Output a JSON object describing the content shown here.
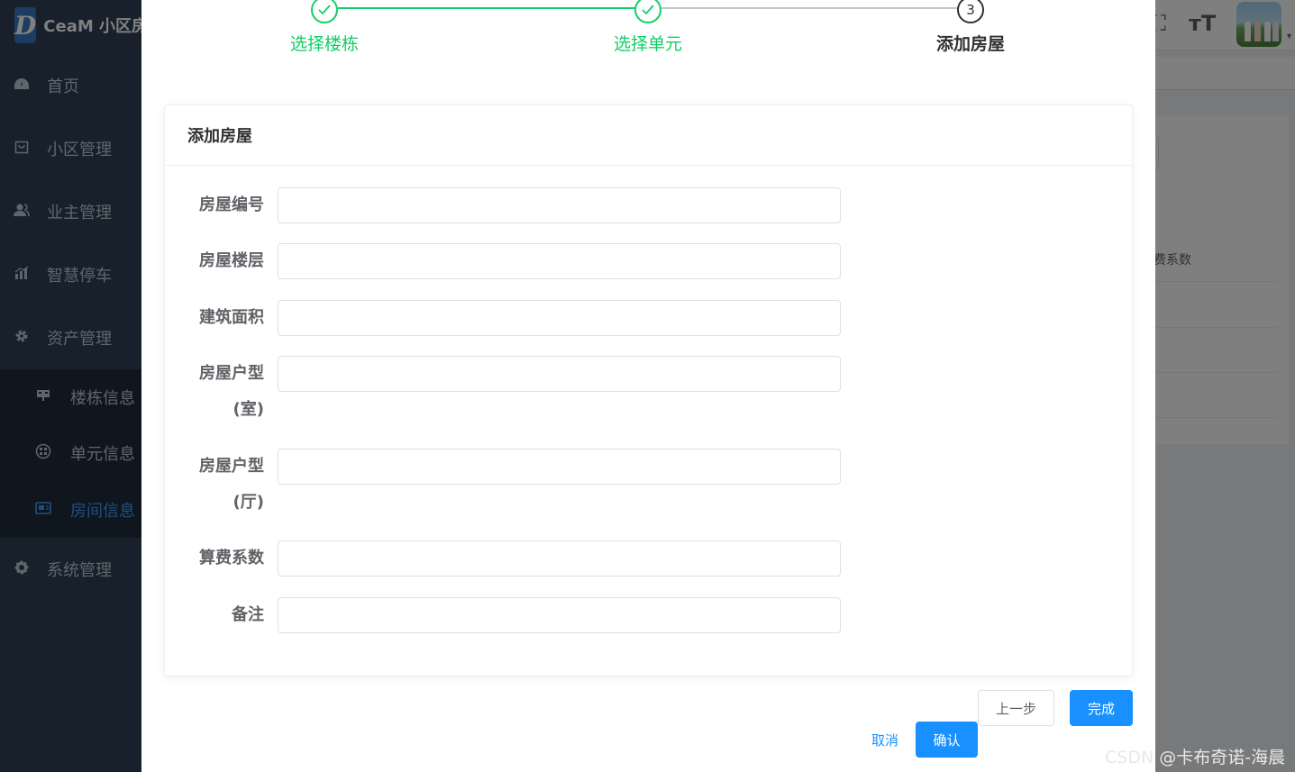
{
  "app": {
    "brand_letter": "D",
    "brand_title": "CeaM 小区房"
  },
  "sidebar": {
    "items": [
      {
        "label": "首页",
        "icon": "dashboard-icon"
      },
      {
        "label": "小区管理",
        "icon": "shopping-icon"
      },
      {
        "label": "业主管理",
        "icon": "peoples-icon"
      },
      {
        "label": "智慧停车",
        "icon": "chart-icon"
      },
      {
        "label": "资产管理",
        "icon": "gear-icon"
      },
      {
        "label": "系统管理",
        "icon": "system-icon"
      }
    ],
    "subitems": [
      {
        "label": "楼栋信息",
        "icon": "building-icon"
      },
      {
        "label": "单元信息",
        "icon": "unit-icon"
      },
      {
        "label": "房间信息",
        "icon": "room-icon"
      }
    ],
    "active_subitem": "房间信息"
  },
  "navbar": {
    "fullscreen_icon": "⛶",
    "size_icon": "тT",
    "caret": "▾"
  },
  "background": {
    "column_fragment": "费系数"
  },
  "steps": [
    {
      "index": "✓",
      "title": "选择楼栋",
      "status": "done"
    },
    {
      "index": "✓",
      "title": "选择单元",
      "status": "done"
    },
    {
      "index": "3",
      "title": "添加房屋",
      "status": "process"
    }
  ],
  "card": {
    "title": "添加房屋"
  },
  "form": {
    "fields": [
      {
        "label": "房屋编号",
        "value": "",
        "placeholder": ""
      },
      {
        "label": "房屋楼层",
        "value": "",
        "placeholder": ""
      },
      {
        "label": "建筑面积",
        "value": "",
        "placeholder": ""
      },
      {
        "label": "房屋户型",
        "label2": "(室)",
        "value": "",
        "placeholder": ""
      },
      {
        "label": "房屋户型",
        "label2": "(厅)",
        "value": "",
        "placeholder": ""
      },
      {
        "label": "算费系数",
        "value": "",
        "placeholder": ""
      },
      {
        "label": "备注",
        "value": "",
        "placeholder": ""
      }
    ]
  },
  "buttons": {
    "prev": "上一步",
    "finish": "完成",
    "cancel": "取消",
    "confirm": "确认"
  },
  "watermark": "CSDN @卡布奇诺-海晨",
  "colors": {
    "sidebar_bg": "#304156",
    "success": "#13ce66",
    "primary": "#1890ff",
    "active_menu": "#409eff"
  }
}
